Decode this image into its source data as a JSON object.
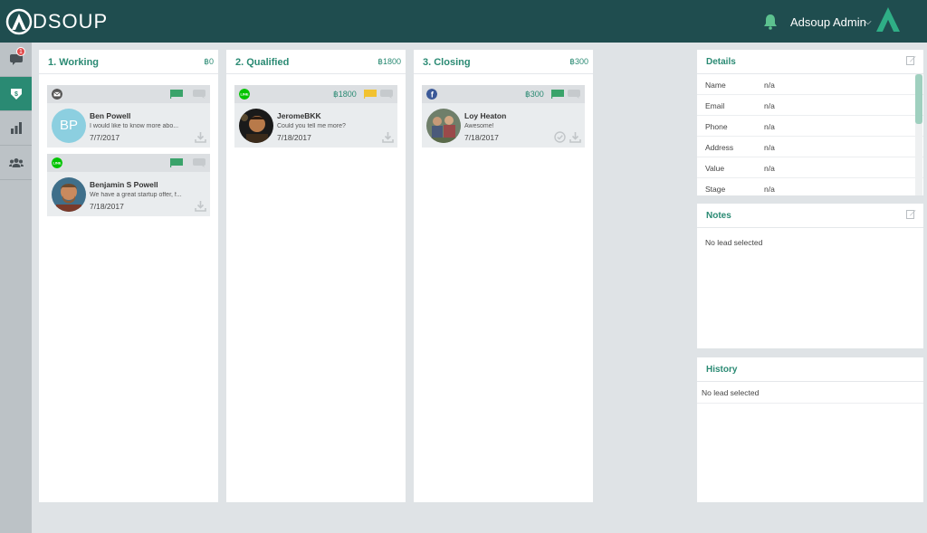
{
  "header": {
    "logo_text": "DSOUP",
    "user_name": "Adsoup Admin",
    "user_chevron": "⌵"
  },
  "nav": {
    "chat_badge": "1",
    "items": [
      {
        "name": "chat",
        "icon": "chat-icon"
      },
      {
        "name": "sales",
        "icon": "money-tag-icon",
        "active": true
      },
      {
        "name": "reports",
        "icon": "bar-chart-icon"
      },
      {
        "name": "contacts",
        "icon": "users-icon"
      }
    ]
  },
  "columns": [
    {
      "title": "1. Working",
      "total": "฿0",
      "cards": [
        {
          "source": "email",
          "initials": "BP",
          "name": "Ben Powell",
          "message": "I would like to know more abo...",
          "date": "7/7/2017",
          "flag": "green"
        },
        {
          "source": "line",
          "name": "Benjamin S Powell",
          "message": "We have a great startup offer, f...",
          "date": "7/18/2017",
          "flag": "green"
        }
      ]
    },
    {
      "title": "2. Qualified",
      "total": "฿1800",
      "cards": [
        {
          "source": "line",
          "amount": "฿1800",
          "name": "JeromeBKK",
          "message": "Could you tell me more?",
          "date": "7/18/2017",
          "flag": "yellow"
        }
      ]
    },
    {
      "title": "3. Closing",
      "total": "฿300",
      "cards": [
        {
          "source": "facebook",
          "amount": "฿300",
          "name": "Loy Heaton",
          "message": "Awesome!",
          "date": "7/18/2017",
          "flag": "green"
        }
      ]
    }
  ],
  "details": {
    "title": "Details",
    "rows": [
      {
        "label": "Name",
        "value": "n/a"
      },
      {
        "label": "Email",
        "value": "n/a"
      },
      {
        "label": "Phone",
        "value": "n/a"
      },
      {
        "label": "Address",
        "value": "n/a"
      },
      {
        "label": "Value",
        "value": "n/a"
      },
      {
        "label": "Stage",
        "value": "n/a"
      }
    ]
  },
  "notes": {
    "title": "Notes",
    "empty": "No lead selected"
  },
  "history": {
    "title": "History",
    "empty": "No lead selected"
  },
  "colors": {
    "accent": "#2a8a73",
    "header": "#1f4d4f",
    "flag_green": "#3aa36a",
    "flag_yellow": "#f2c230"
  }
}
